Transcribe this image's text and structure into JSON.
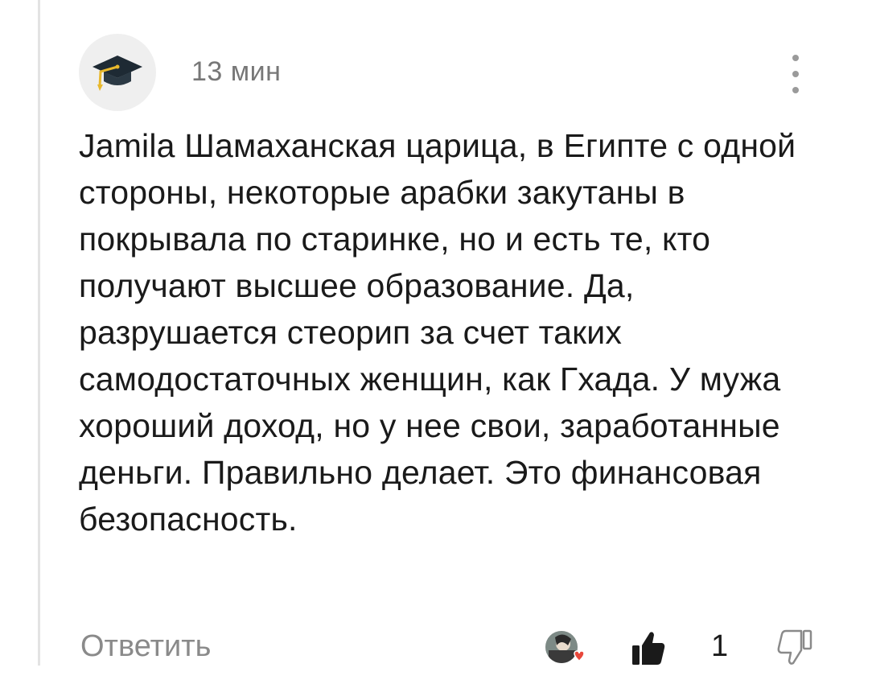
{
  "comment": {
    "timestamp": "13 мин",
    "avatar_icon": "graduation-cap-icon",
    "text": "Jamila Шамаханская царица, в Египте с одной стороны, некоторые арабки закутаны в покрывала по старинке, но и есть те, кто получают высшее образование. Да, разрушается стеорип за счет таких самодостаточных женщин, как Гхада. У мужа хороший доход, но у нее свои, заработанные деньги. Правильно делает. Это финансовая безопасность.",
    "more_icon": "more-vertical-icon"
  },
  "actions": {
    "reply_label": "Ответить",
    "reactor_icon": "reactor-avatar-heart-icon",
    "like_icon": "thumbs-up-icon",
    "like_count": "1",
    "dislike_icon": "thumbs-down-icon"
  },
  "colors": {
    "muted_text": "#8a8a8a",
    "body_text": "#1a1a1a",
    "avatar_bg": "#efefef",
    "heart": "#e8483c",
    "cap_tassel": "#e8b82c"
  }
}
